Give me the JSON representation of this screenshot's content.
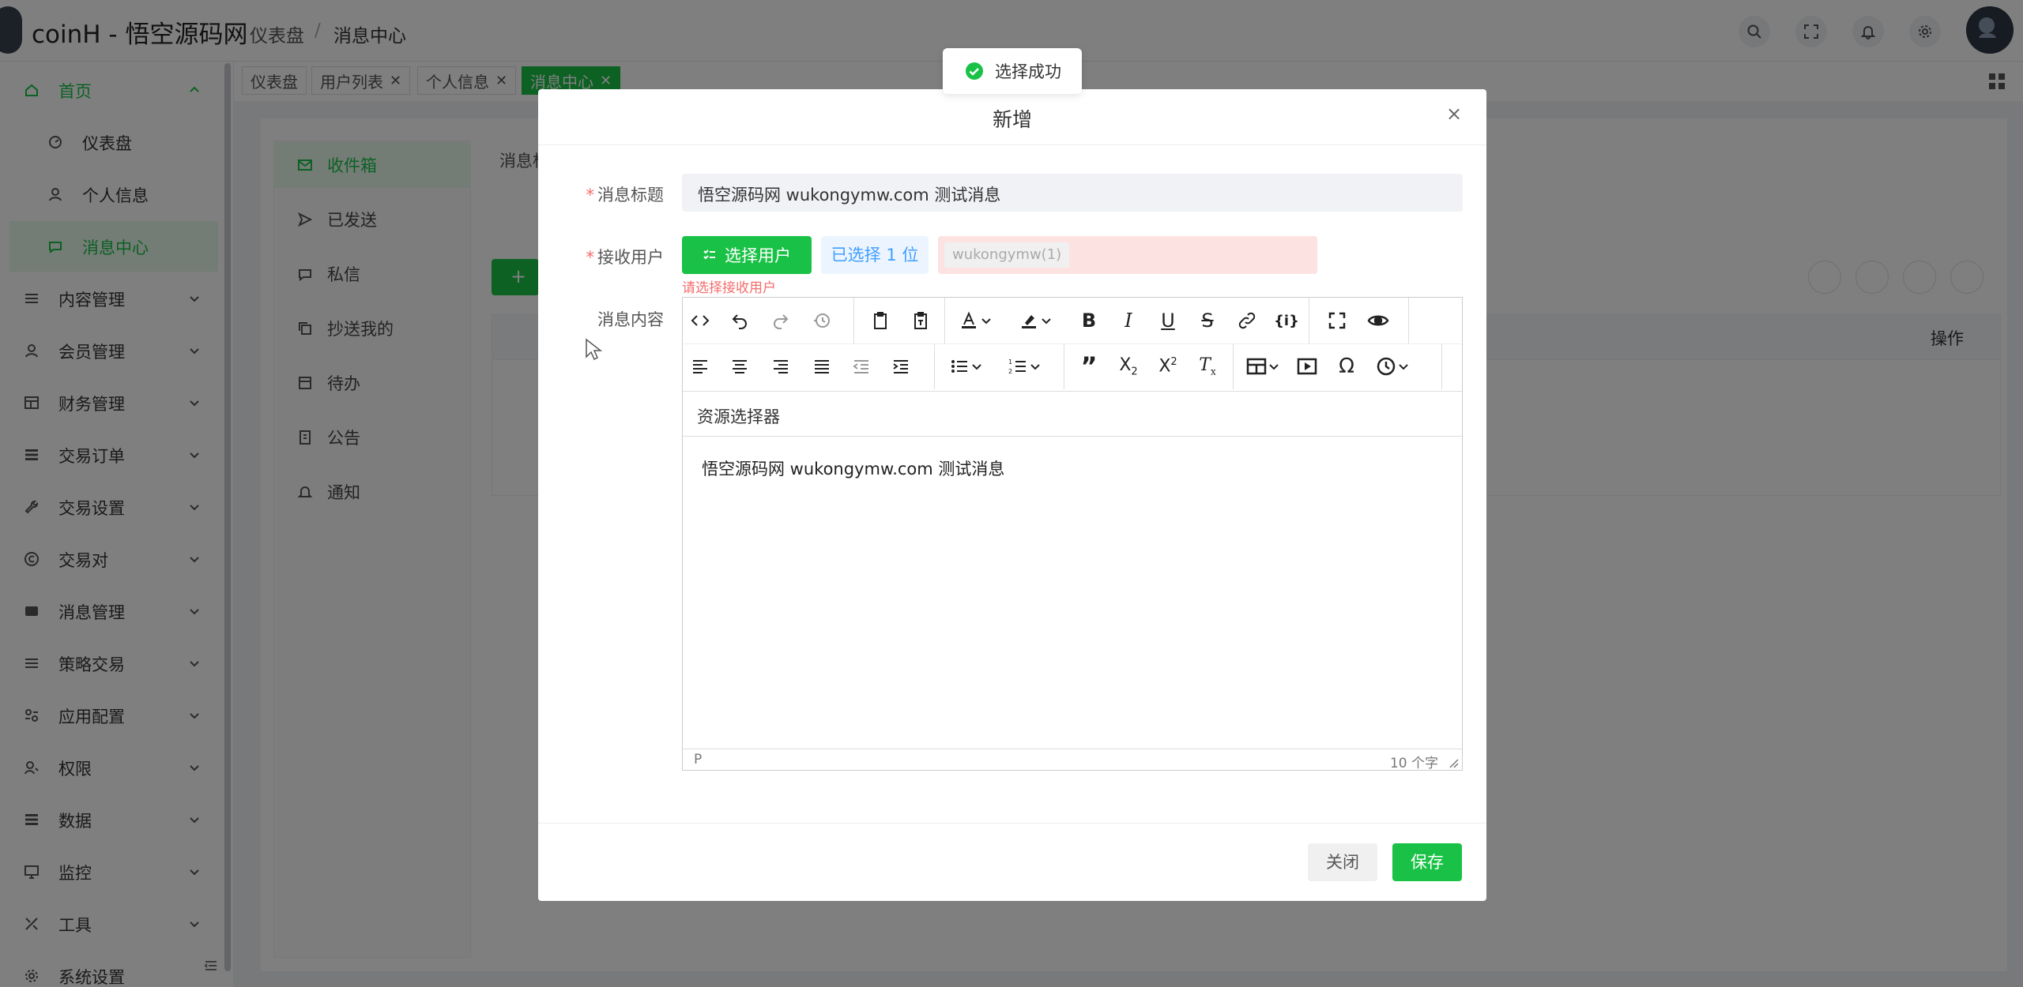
{
  "header": {
    "app_title": "coinH - 悟空源码网",
    "breadcrumb": [
      "仪表盘",
      "/",
      "消息中心"
    ]
  },
  "sidebar": {
    "home": "首页",
    "sub_items": [
      "仪表盘",
      "个人信息",
      "消息中心"
    ],
    "groups": [
      "内容管理",
      "会员管理",
      "财务管理",
      "交易订单",
      "交易设置",
      "交易对",
      "消息管理",
      "策略交易",
      "应用配置",
      "权限",
      "数据",
      "监控",
      "工具",
      "系统设置"
    ]
  },
  "tags": [
    "仪表盘",
    "用户列表",
    "个人信息",
    "消息中心"
  ],
  "message_nav": [
    "收件箱",
    "已发送",
    "私信",
    "抄送我的",
    "待办",
    "公告",
    "通知"
  ],
  "content": {
    "list_title_partial": "消息标",
    "add_button": "+",
    "operate_header": "操作"
  },
  "dialog": {
    "title": "新增",
    "close_icon": "×",
    "fields": {
      "title_label": "消息标题",
      "title_value": "悟空源码网 wukongymw.com 测试消息",
      "receiver_label": "接收用户",
      "select_user_button": "选择用户",
      "selected_count": "已选择 1 位",
      "user_tag": "wukongymw(1)",
      "receiver_error": "请选择接收用户",
      "content_label": "消息内容"
    },
    "editor": {
      "resource_selector": "资源选择器",
      "text": "悟空源码网 wukongymw.com 测试消息",
      "status_path": "P",
      "word_count": "10 个字"
    },
    "buttons": {
      "close": "关闭",
      "save": "保存"
    }
  },
  "toast": {
    "message": "选择成功"
  },
  "colors": {
    "primary": "#19c246",
    "danger": "#f56c6c",
    "info": "#409eff"
  }
}
